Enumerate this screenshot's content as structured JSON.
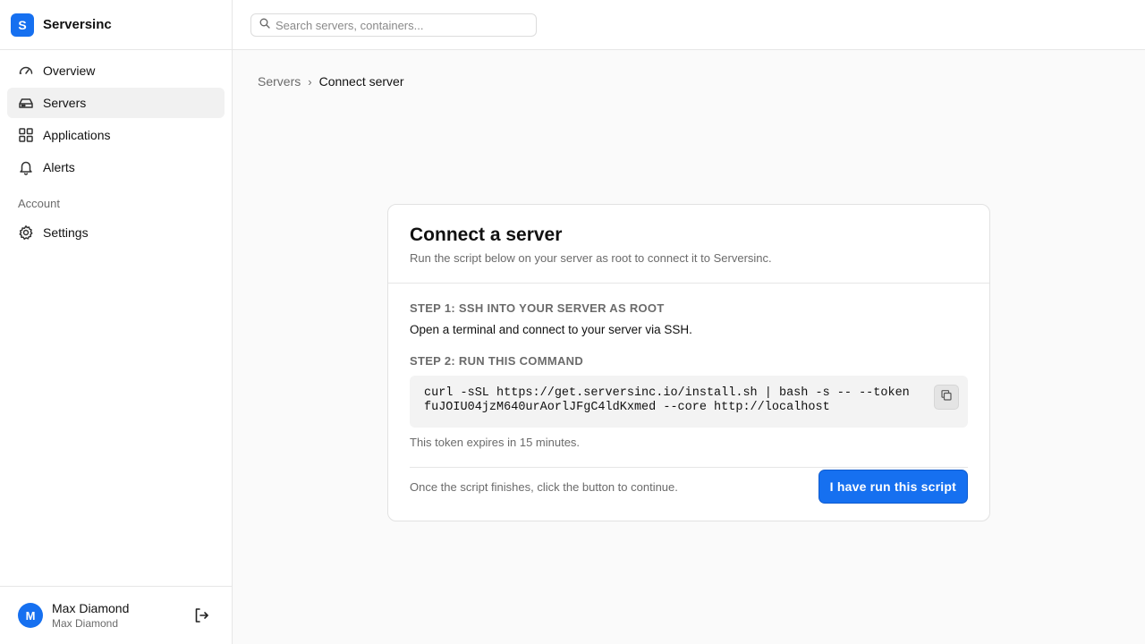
{
  "app": {
    "logo_letter": "S",
    "name": "Serversinc"
  },
  "search": {
    "placeholder": "Search servers, containers..."
  },
  "sidebar": {
    "items": [
      {
        "label": "Overview",
        "icon": "gauge-icon",
        "active": false
      },
      {
        "label": "Servers",
        "icon": "server-icon",
        "active": true
      },
      {
        "label": "Applications",
        "icon": "grid-icon",
        "active": false
      },
      {
        "label": "Alerts",
        "icon": "bell-icon",
        "active": false
      }
    ],
    "section_label": "Account",
    "account_items": [
      {
        "label": "Settings",
        "icon": "gear-icon"
      }
    ]
  },
  "user": {
    "initial": "M",
    "name": "Max Diamond",
    "subtitle": "Max Diamond"
  },
  "breadcrumb": {
    "parent": "Servers",
    "separator": "›",
    "current": "Connect server"
  },
  "card": {
    "title": "Connect a server",
    "description": "Run the script below on your server as root to connect it to Serversinc.",
    "step1_title": "STEP 1: SSH INTO YOUR SERVER AS ROOT",
    "step1_text": "Open a terminal and connect to your server via SSH.",
    "step2_title": "STEP 2: RUN THIS COMMAND",
    "command": "curl -sSL https://get.serversinc.io/install.sh | bash -s -- --token fuJOIU04jzM640urAorlJFgC4ldKxmed --core http://localhost",
    "expiry_text": "This token expires in 15 minutes.",
    "footer_text": "Once the script finishes, click the button to continue.",
    "confirm_button": "I have run this script"
  },
  "colors": {
    "accent": "#1670f0",
    "muted_text": "#6b6b6b",
    "page_bg": "#fafafa"
  }
}
